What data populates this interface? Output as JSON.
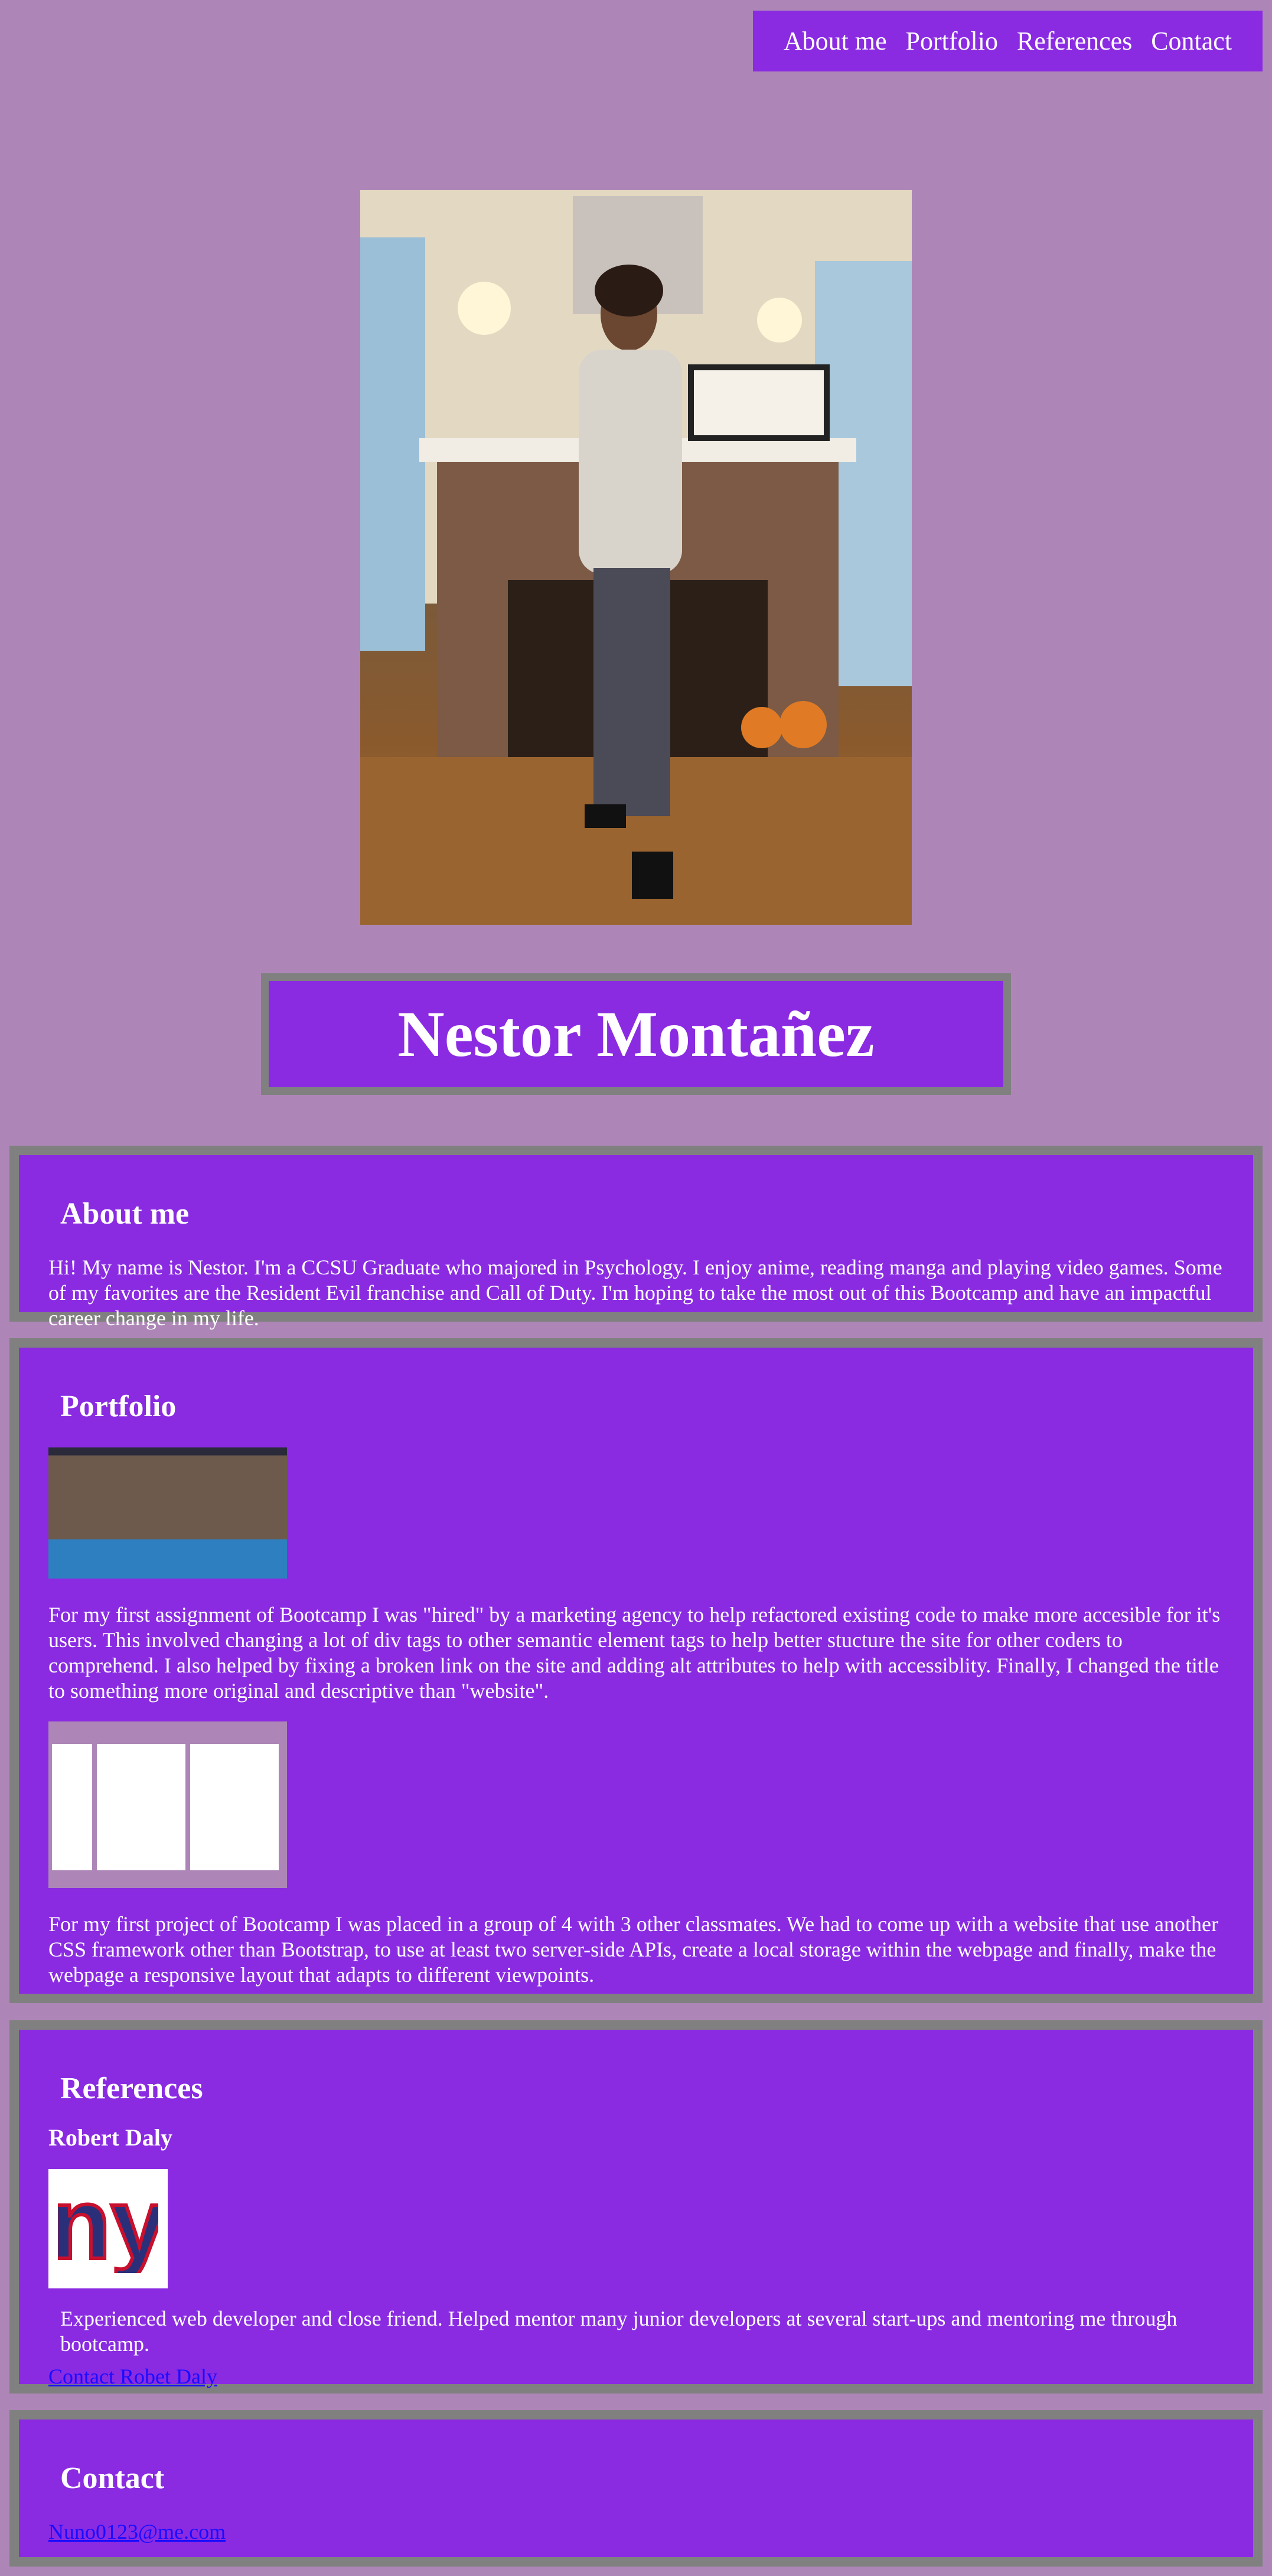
{
  "nav": {
    "items": [
      "About me",
      "Portfolio",
      "References",
      "Contact"
    ]
  },
  "hero": {
    "photo_icon": "person-photo",
    "name": "Nestor Montañez"
  },
  "about": {
    "heading": "About me",
    "text": "Hi! My name is Nestor. I'm a CCSU Graduate who majored in Psychology. I enjoy anime, reading manga and playing video games. Some of my favorites are the Resident Evil franchise and Call of Duty. I'm hoping to take the most out of this Bootcamp and have an impactful career change in my life."
  },
  "portfolio": {
    "heading": "Portfolio",
    "projects": [
      {
        "text": "For my first assignment of Bootcamp I was \"hired\" by a marketing agency to help refactored existing code to make more accesible for it's users. This involved changing a lot of div tags to other semantic element tags to help better stucture the site for other coders to comprehend. I also helped by fixing a broken link on the site and adding alt attributes to help with accessiblity. Finally, I changed the title to something more original and descriptive than \"website\"."
      },
      {
        "text": "For my first project of Bootcamp I was placed in a group of 4 with 3 other classmates. We had to come up with a website that use another CSS framework other than Bootstrap, to use at least two server-side APIs, create a local storage within the webpage and finally, make the webpage a responsive layout that adapts to different viewpoints."
      }
    ]
  },
  "references": {
    "heading": "References",
    "name": "Robert Daly",
    "logo_icon": "ny-giants-logo",
    "logo_text": "ny",
    "text": "Experienced web developer and close friend. Helped mentor many junior developers at several start-ups and mentoring me through bootcamp.",
    "link": "Contact Robet Daly"
  },
  "contact": {
    "heading": "Contact",
    "email": "Nuno0123@me.com"
  },
  "colors": {
    "page_bg": "#ad86b7",
    "panel": "#8a2be2",
    "border": "#808080",
    "link": "#1a0dff"
  }
}
